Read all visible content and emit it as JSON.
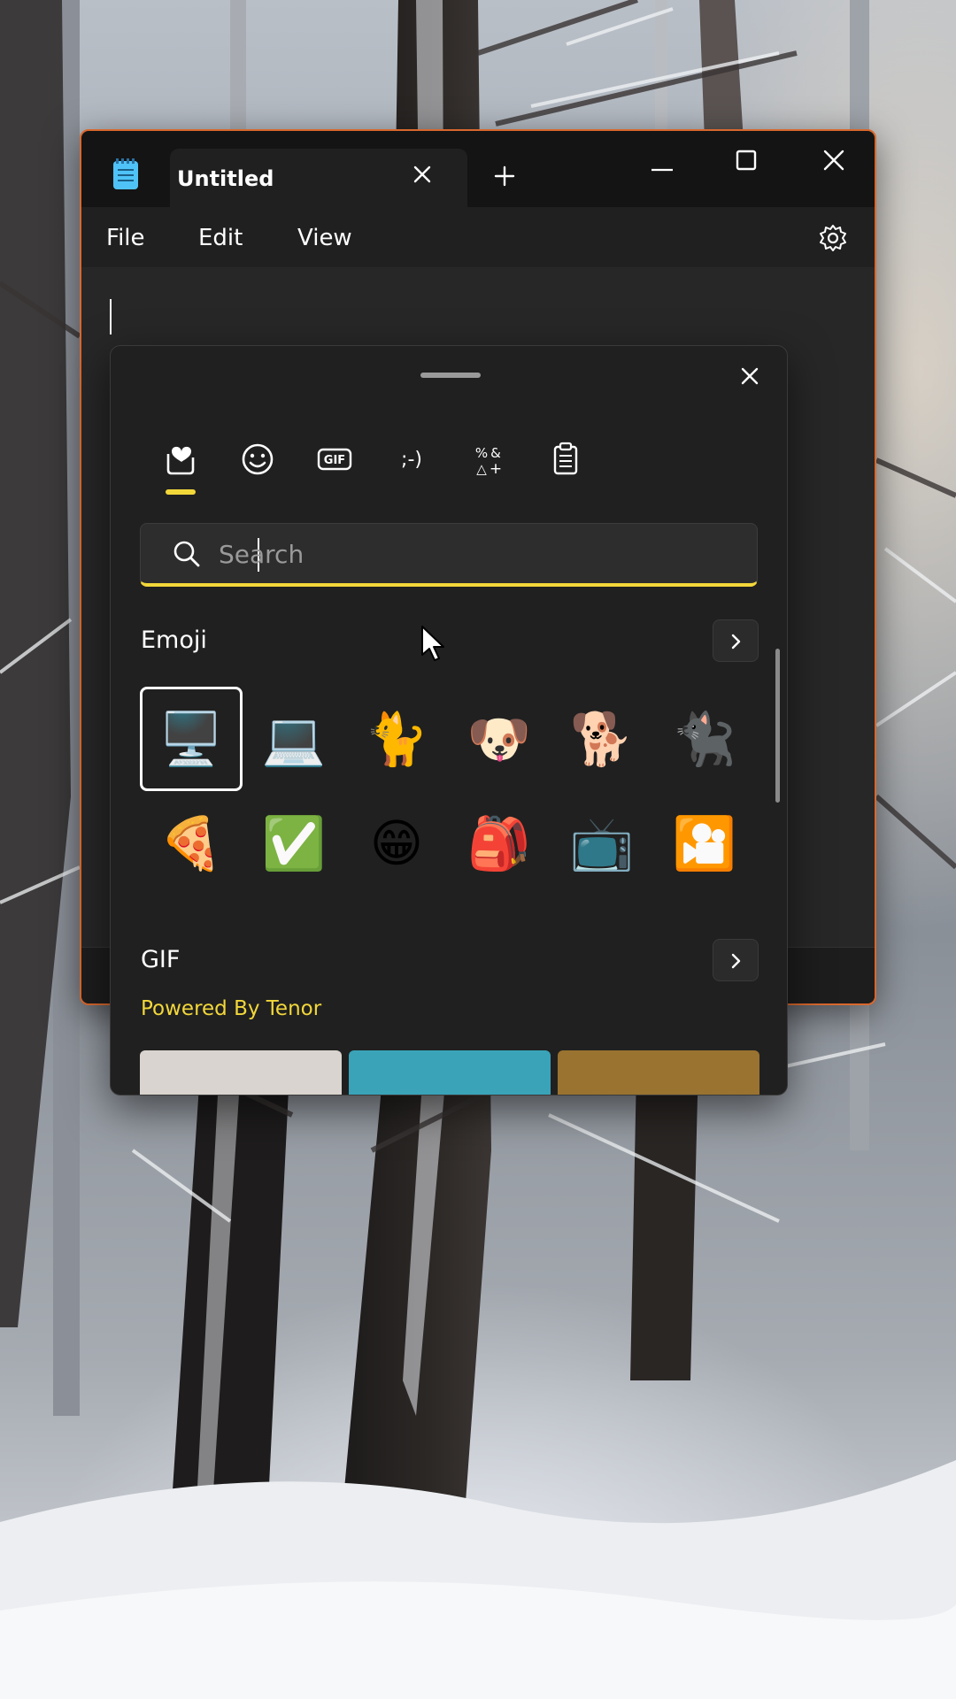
{
  "window": {
    "tab_title": "Untitled",
    "menu": [
      "File",
      "Edit",
      "View"
    ],
    "accent_color": "#d8682e"
  },
  "emoji_panel": {
    "category_tabs": [
      {
        "name": "most-used",
        "icon": "heart-sticker-icon",
        "active": true
      },
      {
        "name": "emoji",
        "icon": "smiley-icon",
        "active": false
      },
      {
        "name": "gif",
        "icon": "gif-icon",
        "active": false
      },
      {
        "name": "kaomoji",
        "icon": ";-)",
        "active": false
      },
      {
        "name": "symbols",
        "icon": "symbols-icon",
        "active": false
      },
      {
        "name": "clipboard",
        "icon": "clipboard-icon",
        "active": false
      }
    ],
    "search": {
      "placeholder": "Search",
      "value": ""
    },
    "emoji_section": {
      "title": "Emoji",
      "rows": [
        [
          {
            "glyph": "🖥️",
            "name": "desktop-computer-emoji",
            "selected": true
          },
          {
            "glyph": "💻",
            "name": "laptop-emoji",
            "selected": false
          },
          {
            "glyph": "🐈",
            "name": "cat-emoji",
            "selected": false
          },
          {
            "glyph": "🐶",
            "name": "dog-face-emoji",
            "selected": false
          },
          {
            "glyph": "🐕",
            "name": "dog-emoji",
            "selected": false
          },
          {
            "glyph": "🐈‍⬛",
            "name": "black-cat-emoji",
            "selected": false
          }
        ],
        [
          {
            "glyph": "🍕",
            "name": "pizza-emoji",
            "selected": false
          },
          {
            "glyph": "✅",
            "name": "check-mark-button-emoji",
            "selected": false
          },
          {
            "glyph": "😁",
            "name": "beaming-face-emoji",
            "selected": false
          },
          {
            "glyph": "🎒",
            "name": "backpack-emoji",
            "selected": false
          },
          {
            "glyph": "📺",
            "name": "television-emoji",
            "selected": false
          },
          {
            "glyph": "🎦",
            "name": "cinema-emoji",
            "selected": false
          }
        ]
      ]
    },
    "gif_section": {
      "title": "GIF",
      "powered_by": "Powered By Tenor",
      "thumb_colors": [
        "#d9d4cf",
        "#3aa3b8",
        "#9a7330"
      ]
    }
  }
}
